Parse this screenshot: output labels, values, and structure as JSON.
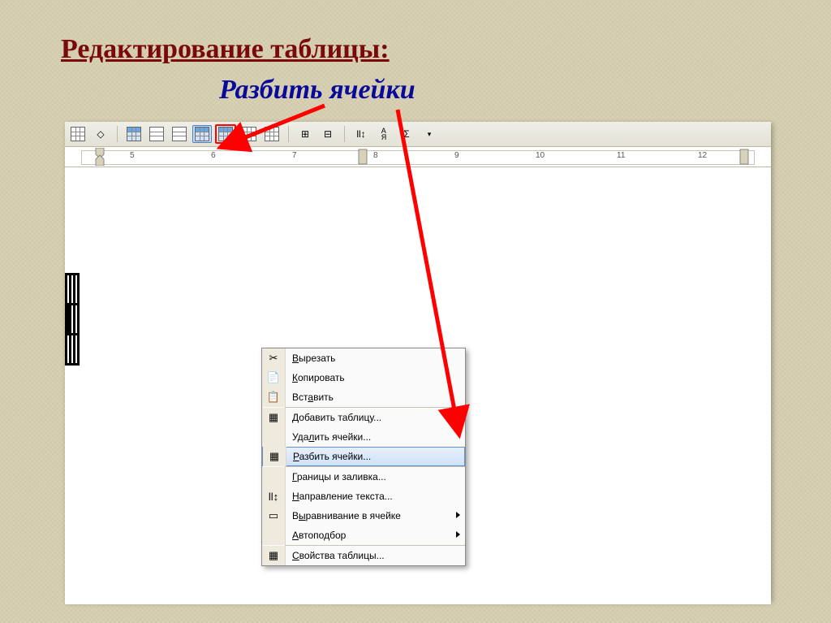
{
  "title": "Редактирование таблицы:",
  "subtitle": "Разбить ячейки",
  "ruler": {
    "ticks": [
      "5",
      "6",
      "7",
      "8",
      "9",
      "10",
      "11",
      "12"
    ]
  },
  "context_menu": {
    "cut": "Вырезать",
    "copy": "Копировать",
    "paste": "Вставить",
    "insert_table": "Добавить таблицу...",
    "delete_cells": "Удалить ячейки...",
    "split_cells": "Разбить ячейки...",
    "borders_shading": "Границы и заливка...",
    "text_direction": "Направление текста...",
    "cell_alignment": "Выравнивание в ячейке",
    "autofit": "Автоподбор",
    "table_properties": "Свойства таблицы..."
  },
  "icons": {
    "cut": "✂",
    "copy": "📄",
    "paste": "📋",
    "table": "▦",
    "direction": "ll↕",
    "gray": "▭"
  }
}
